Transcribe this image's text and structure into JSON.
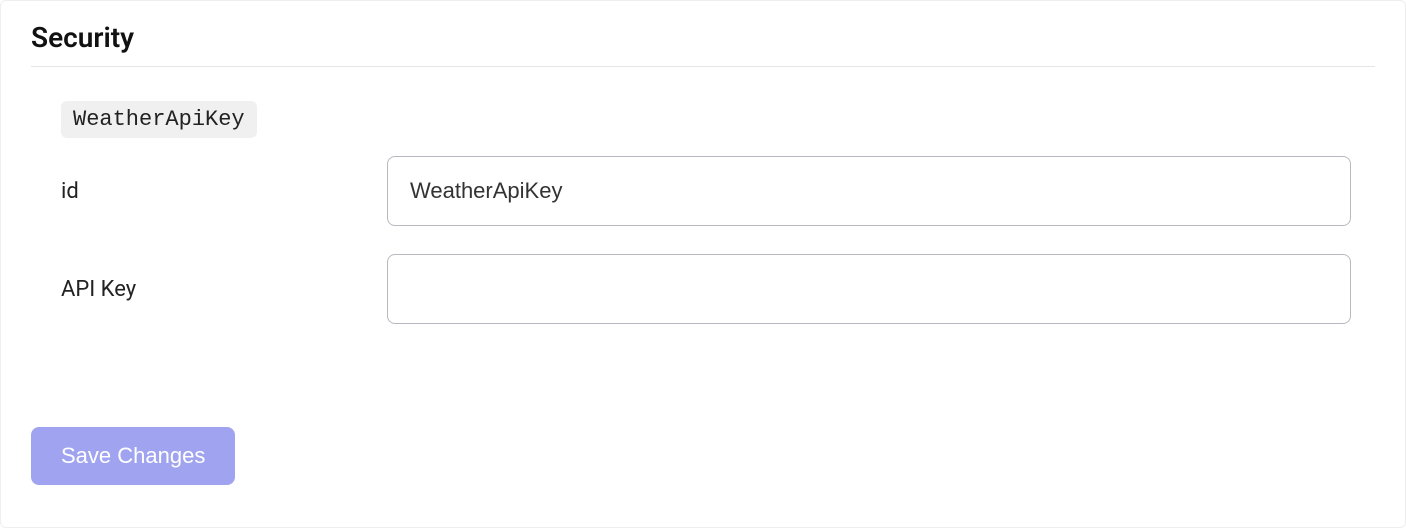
{
  "section": {
    "title": "Security"
  },
  "badge": {
    "name": "WeatherApiKey"
  },
  "fields": {
    "id": {
      "label": "id",
      "value": "WeatherApiKey"
    },
    "apiKey": {
      "label": "API Key",
      "value": ""
    }
  },
  "buttons": {
    "save": "Save Changes"
  }
}
